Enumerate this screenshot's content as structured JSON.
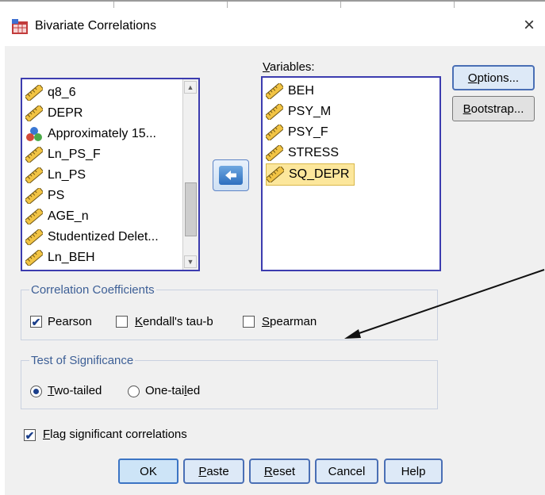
{
  "window": {
    "title": "Bivariate Correlations",
    "close_glyph": "×"
  },
  "source_list": {
    "items": [
      {
        "label": "q8_6",
        "icon": "scale-ruler-icon"
      },
      {
        "label": "DEPR",
        "icon": "scale-ruler-icon"
      },
      {
        "label": "Approximately 15...",
        "icon": "nominal-balls-icon"
      },
      {
        "label": "Ln_PS_F",
        "icon": "scale-ruler-icon"
      },
      {
        "label": "Ln_PS",
        "icon": "scale-ruler-icon"
      },
      {
        "label": "PS",
        "icon": "scale-ruler-icon"
      },
      {
        "label": "AGE_n",
        "icon": "scale-ruler-icon"
      },
      {
        "label": "Studentized Delet...",
        "icon": "scale-ruler-icon"
      },
      {
        "label": "Ln_BEH",
        "icon": "scale-ruler-icon"
      }
    ]
  },
  "variables": {
    "label_prefix": "",
    "label_key": "V",
    "label_rest": "ariables:",
    "items": [
      {
        "label": "BEH",
        "icon": "scale-ruler-icon"
      },
      {
        "label": "PSY_M",
        "icon": "scale-ruler-icon"
      },
      {
        "label": "PSY_F",
        "icon": "scale-ruler-icon"
      },
      {
        "label": "STRESS",
        "icon": "scale-ruler-icon"
      },
      {
        "label": "SQ_DEPR",
        "icon": "scale-ruler-icon"
      }
    ]
  },
  "side_buttons": {
    "options": {
      "key": "O",
      "rest": "ptions..."
    },
    "bootstrap": {
      "key": "B",
      "rest": "ootstrap..."
    }
  },
  "correlation": {
    "legend": "Correlation Coefficients",
    "pearson": {
      "pre": "",
      "key": "",
      "post": "Pearson",
      "checked": true
    },
    "kendall": {
      "pre": "",
      "key": "K",
      "post": "endall's tau-b",
      "checked": false
    },
    "spearman": {
      "pre": "",
      "key": "S",
      "post": "pearman",
      "checked": false
    }
  },
  "significance": {
    "legend": "Test of Significance",
    "two_tailed": {
      "key": "T",
      "post": "wo-tailed",
      "selected": true
    },
    "one_tailed": {
      "pre": "One-tai",
      "key": "l",
      "post": "ed",
      "selected": false
    }
  },
  "flag": {
    "key": "F",
    "post": "lag significant correlations",
    "checked": true
  },
  "bottom_buttons": {
    "ok": "OK",
    "paste": {
      "key": "P",
      "rest": "aste"
    },
    "reset": {
      "key": "R",
      "rest": "eset"
    },
    "cancel": "Cancel",
    "help": "Help"
  },
  "colors": {
    "accent": "#3c3caf",
    "selection": "#fce79c",
    "group_legend": "#3d5f96"
  }
}
